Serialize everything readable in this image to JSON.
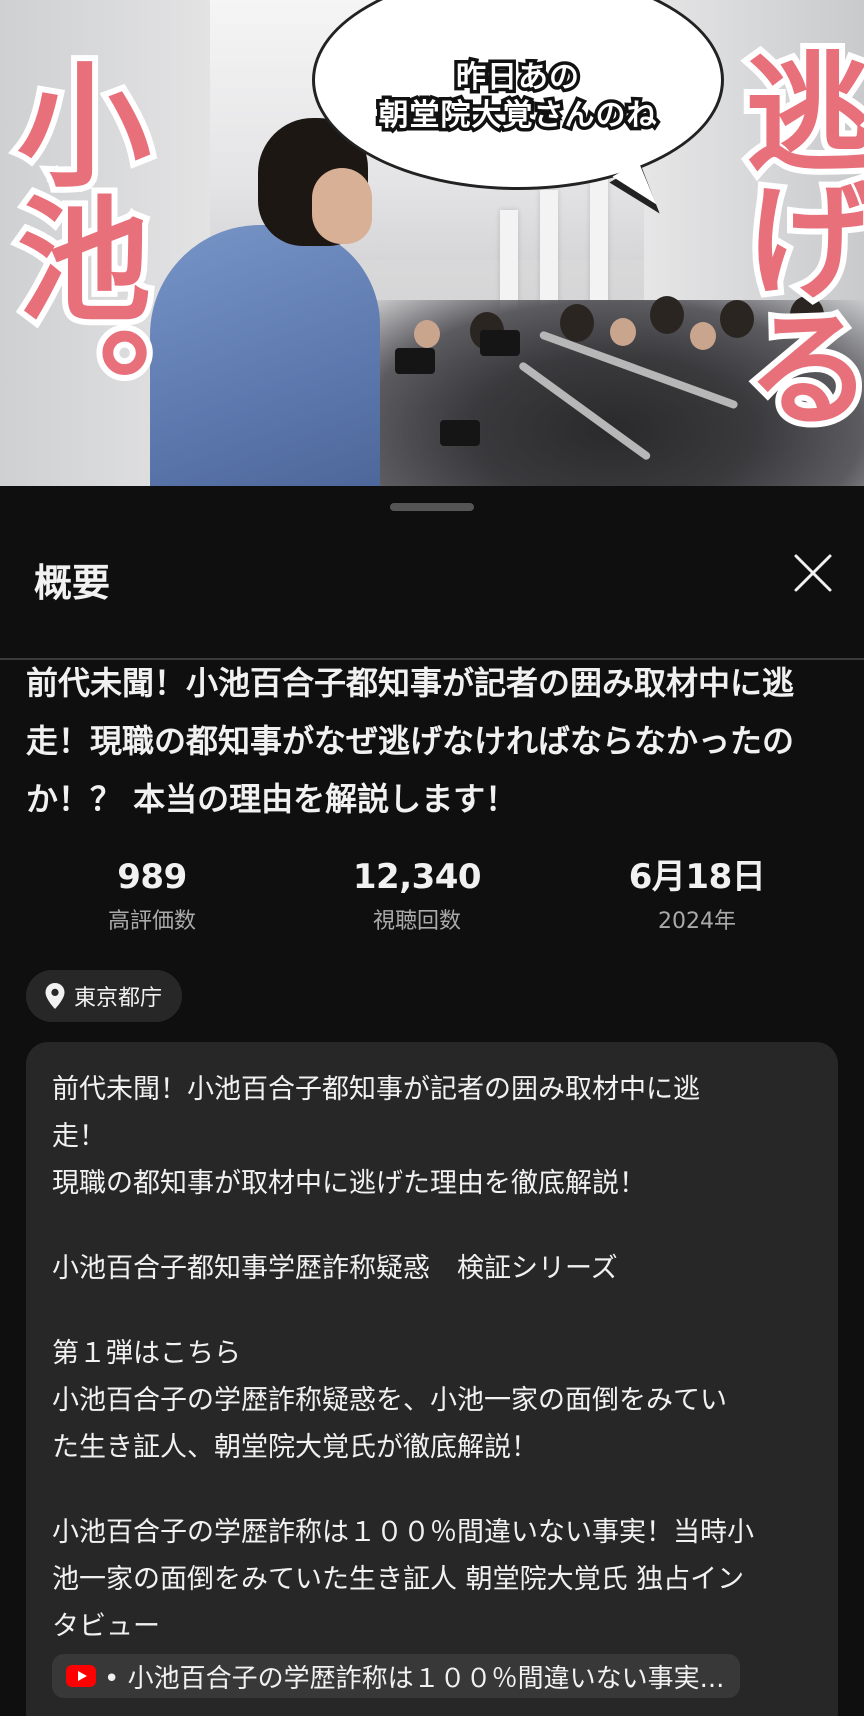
{
  "video": {
    "speech_bubble": [
      "昨日あの",
      "朝堂院大覚さんのね"
    ],
    "overlay_left": "小池。",
    "overlay_right": "逃げる"
  },
  "sheet": {
    "title": "概要",
    "close_icon": "close-icon"
  },
  "video_title": "前代未聞！小池百合子都知事が記者の囲み取材中に逃走！現職の都知事がなぜ逃げなければならなかったのか！？ 本当の理由を解説します！",
  "stats": {
    "likes": {
      "value": "989",
      "label": "高評価数"
    },
    "views": {
      "value": "12,340",
      "label": "視聴回数"
    },
    "date": {
      "value": "6月18日",
      "label": "2024年"
    }
  },
  "location": {
    "icon": "location-pin-icon",
    "text": "東京都庁"
  },
  "description": {
    "lines": [
      "前代未聞！小池百合子都知事が記者の囲み取材中に逃",
      "走！",
      "現職の都知事が取材中に逃げた理由を徹底解説！",
      "",
      "小池百合子都知事学歴詐称疑惑　検証シリーズ",
      "",
      "第１弾はこちら",
      "小池百合子の学歴詐称疑惑を、小池一家の面倒をみてい",
      "た生き証人、朝堂院大覚氏が徹底解説！",
      "",
      "小池百合子の学歴詐称は１００％間違いない事実！当時小",
      "池一家の面倒をみていた生き証人 朝堂院大覚氏 独占イン",
      "タビュー"
    ],
    "link_chip": {
      "icon": "youtube-icon",
      "text": "• 小池百合子の学歴詐称は１００％間違いない事実..."
    }
  }
}
